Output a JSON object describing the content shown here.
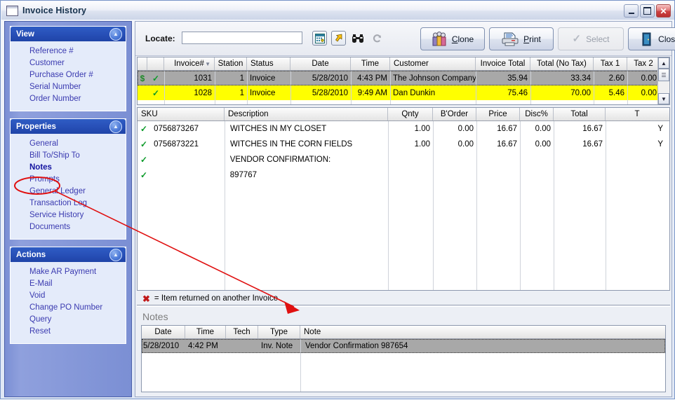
{
  "window": {
    "title": "Invoice History",
    "icon": "window-icon",
    "controls": {
      "minimize": "Minimize",
      "maximize": "Maximize",
      "close": "Close"
    }
  },
  "sidebar": {
    "panels": [
      {
        "title": "View",
        "collapse_icon": "chevron-up-icon",
        "items": [
          {
            "label": "Reference #"
          },
          {
            "label": "Customer"
          },
          {
            "label": "Purchase Order #"
          },
          {
            "label": "Serial Number"
          },
          {
            "label": "Order Number"
          }
        ]
      },
      {
        "title": "Properties",
        "collapse_icon": "chevron-up-icon",
        "items": [
          {
            "label": "General"
          },
          {
            "label": "Bill To/Ship To"
          },
          {
            "label": "Notes",
            "selected": true
          },
          {
            "label": "Prompts"
          },
          {
            "label": "General Ledger"
          },
          {
            "label": "Transaction Log"
          },
          {
            "label": "Service History"
          },
          {
            "label": "Documents"
          }
        ]
      },
      {
        "title": "Actions",
        "collapse_icon": "chevron-up-icon",
        "items": [
          {
            "label": "Make AR Payment"
          },
          {
            "label": "E-Mail"
          },
          {
            "label": "Void"
          },
          {
            "label": "Change PO Number"
          },
          {
            "label": "Query"
          },
          {
            "label": "Reset"
          }
        ]
      }
    ]
  },
  "toolbar": {
    "locate_label": "Locate:",
    "locate_value": "",
    "locate_placeholder": "",
    "icons": [
      {
        "name": "calendar-icon"
      },
      {
        "name": "goto-arrow-icon"
      },
      {
        "name": "binoculars-icon"
      },
      {
        "name": "refresh-icon"
      }
    ],
    "buttons": [
      {
        "label": "Clone",
        "accel": "C",
        "icon": "clone-people-icon",
        "disabled": false
      },
      {
        "label": "Print",
        "accel": "P",
        "icon": "printer-icon",
        "disabled": false
      },
      {
        "label": "Select",
        "accel": "",
        "icon": "check-icon",
        "disabled": true
      },
      {
        "label": "Close",
        "accel": "",
        "icon": "exit-door-icon",
        "disabled": false
      }
    ]
  },
  "invoice_grid": {
    "columns": [
      "",
      "Invoice#",
      "Station",
      "Status",
      "Date",
      "Time",
      "Customer",
      "Invoice Total",
      "Total (No Tax)",
      "Tax 1",
      "Tax 2"
    ],
    "sort_icon": "sort-descending-icon",
    "rows": [
      {
        "flags": [
          "money-icon",
          "check-icon"
        ],
        "invoice": "1031",
        "station": "1",
        "status": "Invoice",
        "date": "5/28/2010",
        "time": "4:43 PM",
        "customer": "The Johnson Company",
        "invoice_total": "35.94",
        "total_no_tax": "33.34",
        "tax1": "2.60",
        "tax2": "0.00",
        "state": "selected"
      },
      {
        "flags": [
          "check-icon"
        ],
        "invoice": "1028",
        "station": "1",
        "status": "Invoice",
        "date": "5/28/2010",
        "time": "9:49 AM",
        "customer": "Dan Dunkin",
        "invoice_total": "75.46",
        "total_no_tax": "70.00",
        "tax1": "5.46",
        "tax2": "0.00",
        "state": "highlight"
      }
    ]
  },
  "line_grid": {
    "columns": [
      "SKU",
      "Description",
      "Qnty",
      "B'Order",
      "Price",
      "Disc%",
      "Total",
      "T"
    ],
    "rows": [
      {
        "flag": "check-icon",
        "sku": "0756873267",
        "description": "WITCHES IN MY CLOSET",
        "qnty": "1.00",
        "border": "0.00",
        "price": "16.67",
        "disc": "0.00",
        "total": "16.67",
        "t": "Y"
      },
      {
        "flag": "check-icon",
        "sku": "0756873221",
        "description": "WITCHES IN THE CORN FIELDS",
        "qnty": "1.00",
        "border": "0.00",
        "price": "16.67",
        "disc": "0.00",
        "total": "16.67",
        "t": "Y"
      },
      {
        "flag": "check-icon",
        "sku": "",
        "description": "VENDOR CONFIRMATION:",
        "qnty": "",
        "border": "",
        "price": "",
        "disc": "",
        "total": "",
        "t": ""
      },
      {
        "flag": "check-icon",
        "sku": "",
        "description": "897767",
        "qnty": "",
        "border": "",
        "price": "",
        "disc": "",
        "total": "",
        "t": ""
      }
    ],
    "footnote": {
      "icon": "red-x-icon",
      "text": "= Item returned on another Invoice"
    }
  },
  "notes_pane": {
    "title": "Notes",
    "columns": [
      "Date",
      "Time",
      "Tech",
      "Type",
      "Note"
    ],
    "rows": [
      {
        "date": "5/28/2010",
        "time": "4:42 PM",
        "tech": "",
        "type": "Inv. Note",
        "note": "Vendor Confirmation 987654",
        "state": "selected"
      }
    ]
  },
  "annotation": {
    "circle_target": "Notes",
    "arrow_color": "#e01010"
  },
  "colors": {
    "accent": "#2850b8",
    "nav_bg": "#7b8fd4",
    "panel_bg": "#e4ebfa",
    "link": "#3a3ab0",
    "highlight_row": "#ffff00",
    "selected_row": "#a8a8a8",
    "annotation": "#e01010",
    "check": "#0a9a28"
  }
}
